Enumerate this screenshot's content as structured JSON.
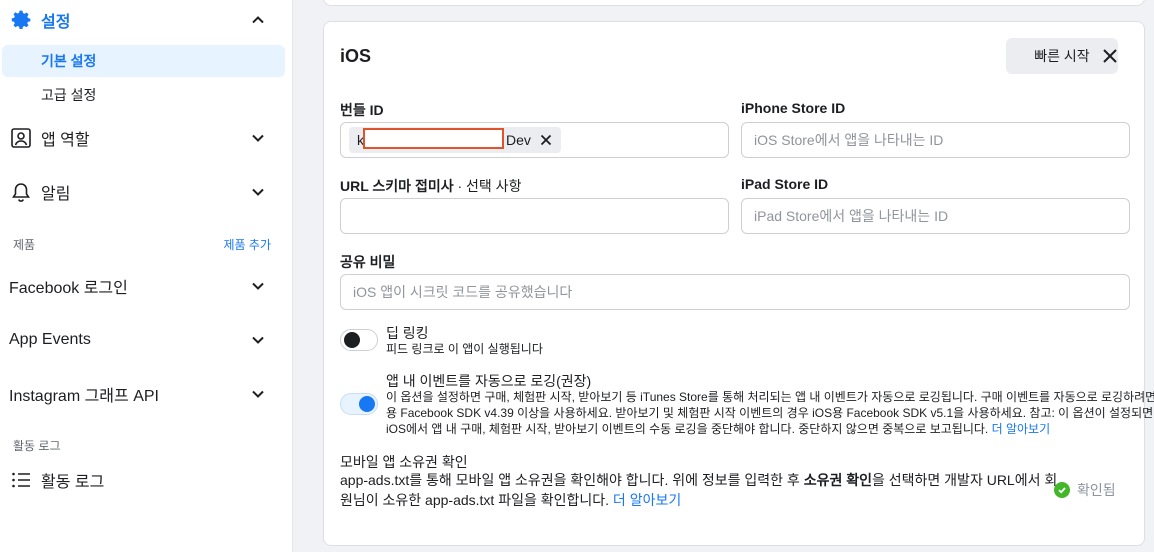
{
  "sidebar": {
    "settings_label": "설정",
    "basic_settings": "기본 설정",
    "advanced_settings": "고급 설정",
    "app_roles": "앱 역할",
    "alerts": "알림",
    "products_heading": "제품",
    "add_product": "제품 추가",
    "facebook_login": "Facebook 로그인",
    "app_events": "App Events",
    "instagram_graph_api": "Instagram 그래프 API",
    "activity_log_heading": "활동 로그",
    "activity_log": "활동 로그"
  },
  "ios_card": {
    "title": "iOS",
    "quick_start": "빠른 시작",
    "bundle_id_label": "번들 ID",
    "bundle_tag_prefix": "k",
    "bundle_tag_suffix": "Dev",
    "iphone_store_label": "iPhone Store ID",
    "iphone_store_placeholder": "iOS Store에서 앱을 나타내는 ID",
    "url_scheme_label": "URL 스키마 접미사",
    "url_scheme_optional": " · 선택 사항",
    "ipad_store_label": "iPad Store ID",
    "ipad_store_placeholder": "iPad Store에서 앱을 나타내는 ID",
    "shared_secret_label": "공유 비밀",
    "shared_secret_placeholder": "iOS 앱이 시크릿 코드를 공유했습니다",
    "deep_linking_title": "딥 링킹",
    "deep_linking_desc": "피드 링크로 이 앱이 실행됩니다",
    "deep_linking_on": false,
    "iap_title": "앱 내 이벤트를 자동으로 로깅(권장)",
    "iap_desc_line1": "이 옵션을 설정하면 구매, 체험판 시작, 받아보기 등 iTunes Store를 통해 처리되는 앱 내 이벤트가 자동으로 로깅됩니다. 구매 이벤트를 자동으로 로깅하려면 iOS",
    "iap_desc_line2": "용 Facebook SDK v4.39 이상을 사용하세요. 받아보기 및 체험판 시작 이벤트의 경우 iOS용 Facebook SDK v5.1을 사용하세요. 참고: 이 옵션이 설정되면",
    "iap_desc_line3": "iOS에서 앱 내 구매, 체험판 시작, 받아보기 이벤트의 수동 로깅을 중단해야 합니다. 중단하지 않으면 중복으로 보고됩니다.",
    "iap_learn_more": "더 알아보기",
    "iap_on": true,
    "ownership_title": "모바일 앱 소유권 확인",
    "ownership_line1_a": "app-ads.txt를 통해 모바일 앱 소유권을 확인해야 합니다. 위에 정보를 입력한 후 ",
    "ownership_line1_bold": "소유권 확인",
    "ownership_line1_b": "을 선택하면 개발자 URL에서 회",
    "ownership_line2": "원님이 소유한 app-ads.txt 파일을 확인합니다.",
    "ownership_learn_more": "더 알아보기",
    "verified_label": "확인됨"
  },
  "colors": {
    "accent": "#1877f2",
    "active_bg": "#e7f3ff",
    "verified": "#42b72a",
    "redaction": "#e0542b"
  }
}
